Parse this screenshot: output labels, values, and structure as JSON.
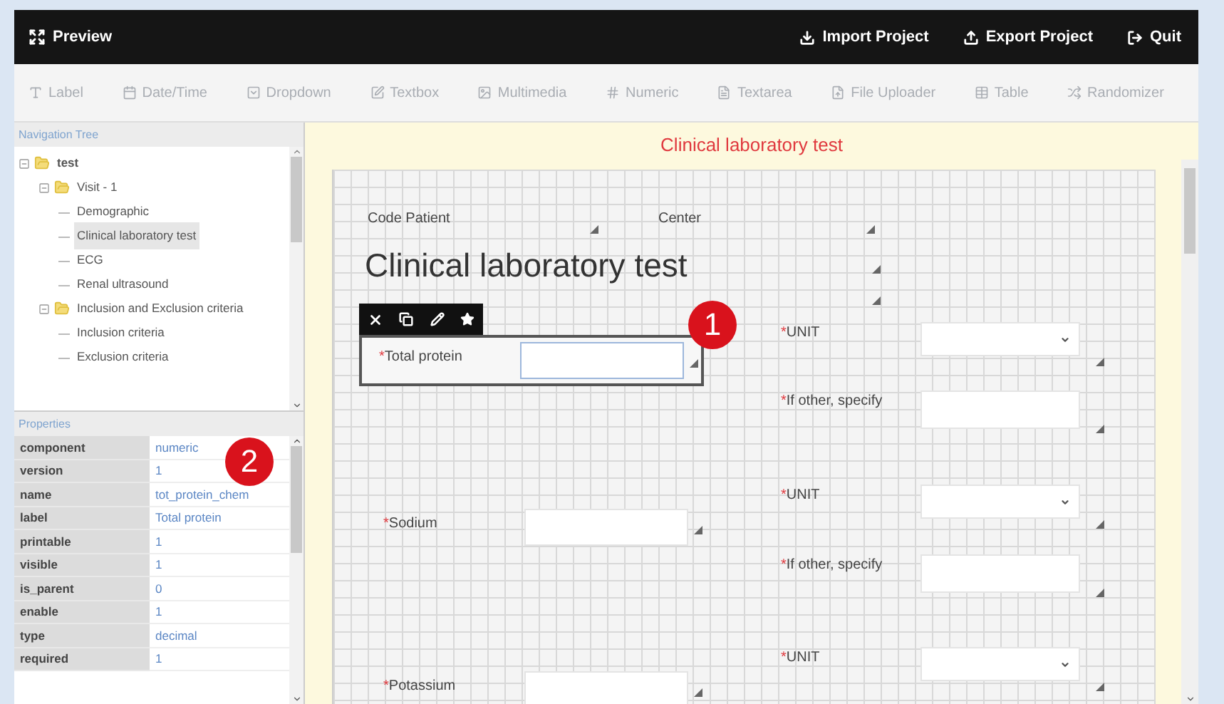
{
  "topbar": {
    "title": "Preview",
    "actions": [
      {
        "kind": "import",
        "label": "Import Project"
      },
      {
        "kind": "export",
        "label": "Export Project"
      },
      {
        "kind": "quit",
        "label": "Quit"
      }
    ]
  },
  "palette": [
    {
      "kind": "label",
      "label": "Label"
    },
    {
      "kind": "datetime",
      "label": "Date/Time"
    },
    {
      "kind": "dropdown",
      "label": "Dropdown"
    },
    {
      "kind": "textbox",
      "label": "Textbox"
    },
    {
      "kind": "multimedia",
      "label": "Multimedia"
    },
    {
      "kind": "numeric",
      "label": "Numeric"
    },
    {
      "kind": "textarea",
      "label": "Textarea"
    },
    {
      "kind": "upload",
      "label": "File Uploader"
    },
    {
      "kind": "table",
      "label": "Table"
    },
    {
      "kind": "randomizer",
      "label": "Randomizer"
    }
  ],
  "navigation": {
    "title": "Navigation Tree",
    "tree": [
      {
        "label": "test",
        "expanded": true,
        "selected": false,
        "children": [
          {
            "label": "Visit - 1",
            "expanded": true,
            "selected": false,
            "children": [
              {
                "label": "Demographic",
                "selected": false
              },
              {
                "label": "Clinical laboratory test",
                "selected": true
              },
              {
                "label": "ECG",
                "selected": false
              },
              {
                "label": "Renal ultrasound",
                "selected": false
              }
            ]
          },
          {
            "label": "Inclusion and Exclusion criteria",
            "expanded": true,
            "selected": false,
            "children": [
              {
                "label": "Inclusion criteria",
                "selected": false
              },
              {
                "label": "Exclusion criteria",
                "selected": false
              }
            ]
          }
        ]
      }
    ]
  },
  "properties": {
    "title": "Properties",
    "rows": [
      {
        "key": "component",
        "value": "numeric"
      },
      {
        "key": "version",
        "value": "1"
      },
      {
        "key": "name",
        "value": "tot_protein_chem"
      },
      {
        "key": "label",
        "value": "Total protein"
      },
      {
        "key": "printable",
        "value": "1"
      },
      {
        "key": "visible",
        "value": "1"
      },
      {
        "key": "is_parent",
        "value": "0"
      },
      {
        "key": "enable",
        "value": "1"
      },
      {
        "key": "type",
        "value": "decimal"
      },
      {
        "key": "required",
        "value": "1"
      }
    ]
  },
  "form": {
    "title": "Clinical laboratory test",
    "fields": [
      {
        "kind": "caption",
        "label": "Code Patient",
        "selected": false
      },
      {
        "kind": "caption",
        "label": "Center",
        "selected": false
      },
      {
        "kind": "heading",
        "label": "Clinical laboratory test",
        "selected": false
      },
      {
        "kind": "number",
        "marker": "*",
        "label": "Total protein",
        "selected": true
      },
      {
        "kind": "select",
        "marker": "*",
        "label": "UNIT",
        "selected": false
      },
      {
        "kind": "text",
        "marker": "*",
        "label": "If other, specify",
        "selected": false
      },
      {
        "kind": "number",
        "marker": "*",
        "label": "Sodium",
        "selected": false
      },
      {
        "kind": "select",
        "marker": "*",
        "label": "UNIT",
        "selected": false
      },
      {
        "kind": "text",
        "marker": "*",
        "label": "If other, specify",
        "selected": false
      },
      {
        "kind": "number",
        "marker": "*",
        "label": "Potassium",
        "selected": false
      },
      {
        "kind": "select",
        "marker": "*",
        "label": "UNIT",
        "selected": false
      }
    ]
  },
  "callouts": [
    "1",
    "2"
  ]
}
